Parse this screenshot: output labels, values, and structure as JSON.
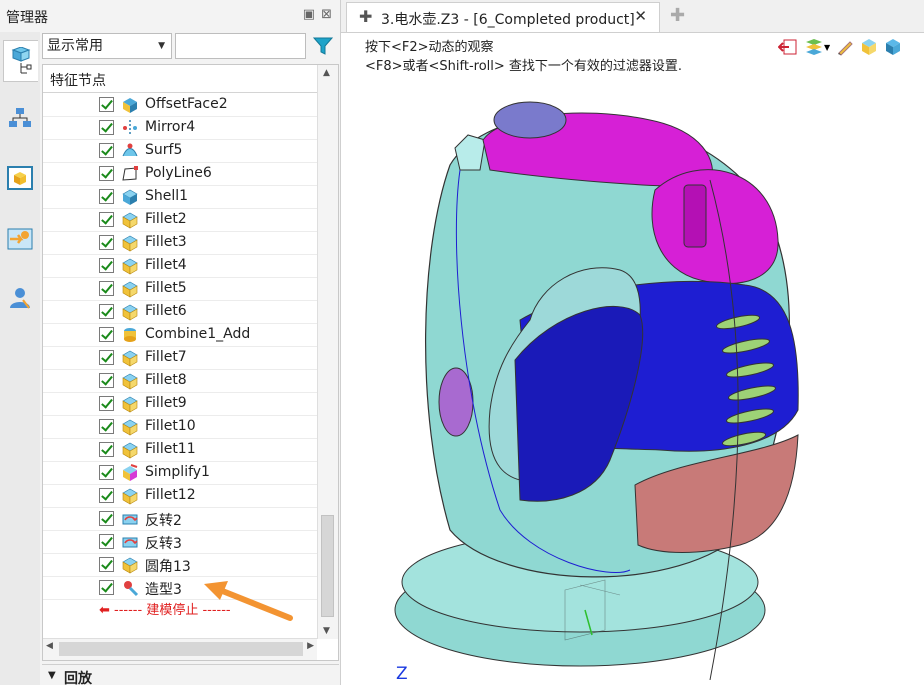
{
  "panel": {
    "title": "管理器",
    "combo_value": "显示常用",
    "tree_header": "特征节点",
    "stop_label": "------ 建模停止 ------",
    "playback_label": "回放"
  },
  "features": [
    {
      "label": "OffsetFace2",
      "icon": "offset-face-icon"
    },
    {
      "label": "Mirror4",
      "icon": "mirror-icon"
    },
    {
      "label": "Surf5",
      "icon": "surface-icon"
    },
    {
      "label": "PolyLine6",
      "icon": "polyline-icon"
    },
    {
      "label": "Shell1",
      "icon": "shell-icon"
    },
    {
      "label": "Fillet2",
      "icon": "fillet-icon"
    },
    {
      "label": "Fillet3",
      "icon": "fillet-icon"
    },
    {
      "label": "Fillet4",
      "icon": "fillet-icon"
    },
    {
      "label": "Fillet5",
      "icon": "fillet-icon"
    },
    {
      "label": "Fillet6",
      "icon": "fillet-icon"
    },
    {
      "label": "Combine1_Add",
      "icon": "combine-icon"
    },
    {
      "label": "Fillet7",
      "icon": "fillet-icon"
    },
    {
      "label": "Fillet8",
      "icon": "fillet-icon"
    },
    {
      "label": "Fillet9",
      "icon": "fillet-icon"
    },
    {
      "label": "Fillet10",
      "icon": "fillet-icon"
    },
    {
      "label": "Fillet11",
      "icon": "fillet-icon"
    },
    {
      "label": "Simplify1",
      "icon": "simplify-icon"
    },
    {
      "label": "Fillet12",
      "icon": "fillet-icon"
    },
    {
      "label": "反转2",
      "icon": "reverse-icon"
    },
    {
      "label": "反转3",
      "icon": "reverse-icon"
    },
    {
      "label": "圆角13",
      "icon": "fillet-icon"
    },
    {
      "label": "造型3",
      "icon": "shape-icon"
    }
  ],
  "document": {
    "tab_title": "3.电水壶.Z3 - [6_Completed product]",
    "hint_line1": "按下<F2>动态的观察",
    "hint_line2": "<F8>或者<Shift-roll> 查找下一个有效的过滤器设置.",
    "axis_label": "Z"
  },
  "colors": {
    "accent": "#1a39e0",
    "stop_red": "#e02020",
    "arrow_orange": "#f39432",
    "teal_body": "#8fd8d2",
    "magenta": "#d620d6",
    "blue": "#1e1ed2",
    "rose": "#c87a78"
  }
}
